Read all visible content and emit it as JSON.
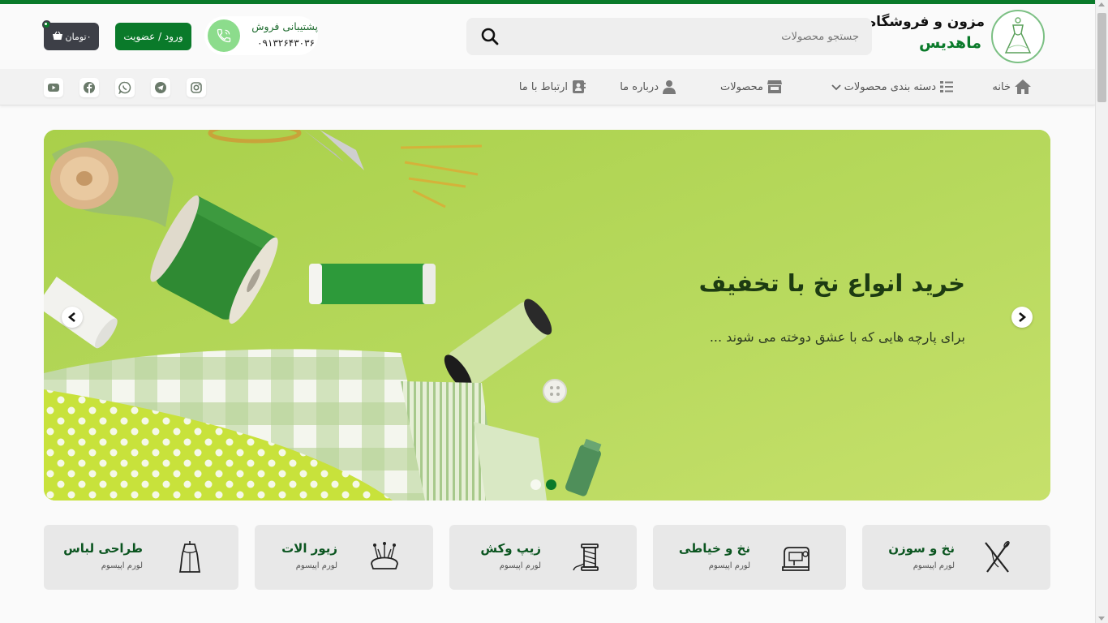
{
  "brand": {
    "line1": "مزون و فروشگاه",
    "line2": "ماهدیس",
    "accent_color": "#0a7a2a"
  },
  "search": {
    "placeholder": "جستجو محصولات",
    "icon": "search-icon"
  },
  "support": {
    "title": "پشتیبانی فروش",
    "phone": "۰۹۱۳۲۶۴۳۰۳۶",
    "icon": "phone-icon"
  },
  "auth": {
    "login_label": "ورود / عضویت"
  },
  "cart": {
    "label": "۰تومان",
    "icon": "basket-icon"
  },
  "nav": {
    "home": "خانه",
    "categories": "دسته بندی محصولات",
    "products": "محصولات",
    "about": "درباره ما",
    "contact": "ارتباط با ما"
  },
  "social": [
    "instagram-icon",
    "telegram-icon",
    "whatsapp-icon",
    "facebook-icon",
    "youtube-icon"
  ],
  "slider": {
    "title": "خرید انواع نخ با تخفیف",
    "subtitle": "برای پارچه هایی که با عشق دوخته می شوند ...",
    "active_slide": 1,
    "slide_count": 2
  },
  "categories": [
    {
      "title": "نخ و سوزن",
      "subtitle": "لورم اپیسوم",
      "icon": "needle-thread-icon"
    },
    {
      "title": "نخ و خیاطی",
      "subtitle": "لورم اپیسوم",
      "icon": "sewing-machine-icon"
    },
    {
      "title": "زیپ وکش",
      "subtitle": "لورم اپیسوم",
      "icon": "thread-spool-icon"
    },
    {
      "title": "زیور الات",
      "subtitle": "لورم اپیسوم",
      "icon": "pin-cushion-icon"
    },
    {
      "title": "طراحی لباس",
      "subtitle": "لورم اپیسوم",
      "icon": "dress-design-icon"
    }
  ]
}
